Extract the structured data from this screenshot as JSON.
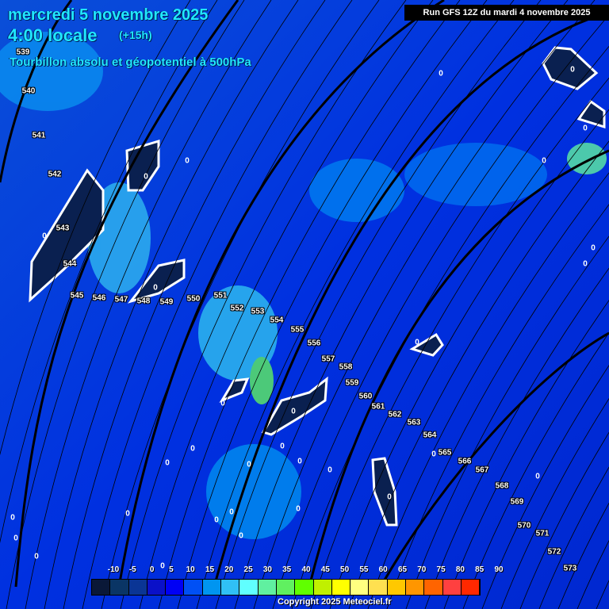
{
  "header": {
    "date": "mercredi 5 novembre 2025",
    "time": "4:00 locale",
    "offset": "(+15h)",
    "parameter": "Tourbillon absolu et géopotentiel à 500hPa",
    "run": "Run GFS 12Z du mardi 4 novembre 2025"
  },
  "contour_labels": [
    "539",
    "540",
    "541",
    "542",
    "543",
    "544",
    "545",
    "546",
    "547",
    "548",
    "549",
    "550",
    "551",
    "552",
    "553",
    "554",
    "555",
    "556",
    "557",
    "558",
    "559",
    "560",
    "561",
    "562",
    "563",
    "564",
    "565",
    "566",
    "567",
    "568",
    "569",
    "570",
    "571",
    "572",
    "573"
  ],
  "zero_label": "0",
  "colorbar": {
    "ticks": [
      "-10",
      "-5",
      "0",
      "5",
      "10",
      "15",
      "20",
      "25",
      "30",
      "35",
      "40",
      "45",
      "50",
      "55",
      "60",
      "65",
      "70",
      "75",
      "80",
      "85",
      "90"
    ],
    "colors": [
      "#0a1838",
      "#0a3565",
      "#0a3595",
      "#0a10c8",
      "#0000f5",
      "#0050f5",
      "#0095f0",
      "#30c0f5",
      "#60ffff",
      "#60f0a0",
      "#60f060",
      "#60ff00",
      "#c0f000",
      "#ffff00",
      "#ffff80",
      "#ffe050",
      "#ffc800",
      "#ff9600",
      "#ff6400",
      "#ff4040",
      "#ff2800"
    ]
  },
  "copyright": "Copyright 2025 Meteociel.fr"
}
